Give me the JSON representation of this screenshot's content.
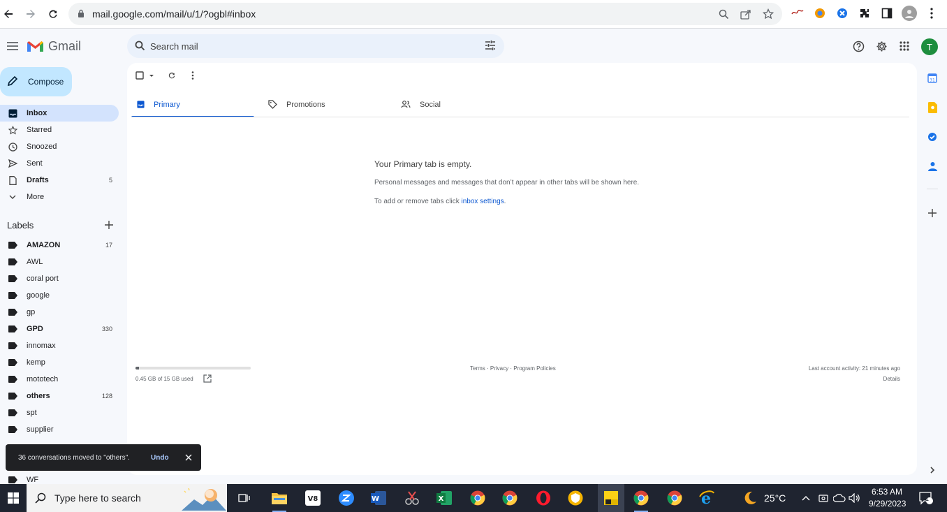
{
  "browser": {
    "url": "mail.google.com/mail/u/1/?ogbl#inbox"
  },
  "app": {
    "name": "Gmail",
    "search_placeholder": "Search mail",
    "avatar_initial": "T"
  },
  "sidebar": {
    "compose_label": "Compose",
    "items": [
      {
        "label": "Inbox",
        "count": "",
        "icon": "inbox-icon",
        "active": true,
        "bold": true
      },
      {
        "label": "Starred",
        "count": "",
        "icon": "star-icon"
      },
      {
        "label": "Snoozed",
        "count": "",
        "icon": "clock-icon"
      },
      {
        "label": "Sent",
        "count": "",
        "icon": "send-icon"
      },
      {
        "label": "Drafts",
        "count": "5",
        "icon": "file-icon",
        "bold": true
      },
      {
        "label": "More",
        "count": "",
        "icon": "chevron-down-icon"
      }
    ],
    "labels_heading": "Labels",
    "labels": [
      {
        "label": "AMAZON",
        "count": "17",
        "bold": true
      },
      {
        "label": "AWL",
        "count": ""
      },
      {
        "label": "coral port",
        "count": ""
      },
      {
        "label": "google",
        "count": ""
      },
      {
        "label": "gp",
        "count": ""
      },
      {
        "label": "GPD",
        "count": "330",
        "bold": true
      },
      {
        "label": "innomax",
        "count": ""
      },
      {
        "label": "kemp",
        "count": ""
      },
      {
        "label": "mototech",
        "count": ""
      },
      {
        "label": "others",
        "count": "128",
        "bold": true
      },
      {
        "label": "spt",
        "count": ""
      },
      {
        "label": "supplier",
        "count": ""
      },
      {
        "label": "WF",
        "count": ""
      }
    ]
  },
  "tabs": [
    {
      "label": "Primary",
      "active": true
    },
    {
      "label": "Promotions"
    },
    {
      "label": "Social"
    }
  ],
  "empty_state": {
    "title": "Your Primary tab is empty.",
    "line1": "Personal messages and messages that don’t appear in other tabs will be shown here.",
    "line2_prefix": "To add or remove tabs click ",
    "line2_link": "inbox settings",
    "line2_suffix": "."
  },
  "footer": {
    "storage_text": "0.45 GB of 15 GB used",
    "storage_fraction": 0.03,
    "terms": "Terms",
    "privacy": "Privacy",
    "policies": "Program Policies",
    "activity": "Last account activity: 21 minutes ago",
    "details": "Details"
  },
  "snackbar": {
    "message": "36 conversations moved to \"others\".",
    "undo": "Undo"
  },
  "taskbar": {
    "search_text": "Type here to search",
    "weather": "25°C",
    "time": "6:53 AM",
    "date": "9/29/2023",
    "notification_count": "1"
  },
  "colors": {
    "accent": "#0b57d0",
    "compose_bg": "#c2e7ff",
    "active_nav": "#d3e3fd",
    "avatar": "#1e8e3e"
  }
}
